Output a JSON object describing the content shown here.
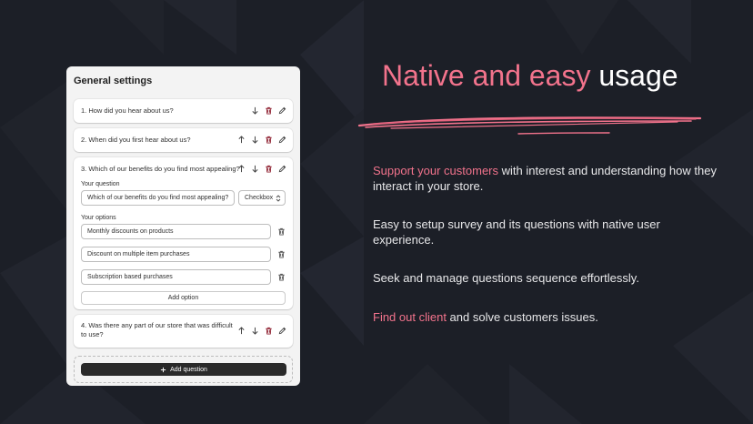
{
  "panel": {
    "title": "General settings",
    "questions": [
      {
        "label": "1. How did you hear about us?"
      },
      {
        "label": "2. When did you first hear about us?"
      },
      {
        "label": "3. Which of our benefits do you find most appealing?",
        "your_question_label": "Your question",
        "question_value": "Which of our benefits do you find most appealing?",
        "type_value": "Checkbox",
        "options_label": "Your options",
        "options": [
          "Monthly discounts on products",
          "Discount on multiple item purchases",
          "Subscription based purchases"
        ],
        "add_option_label": "Add option"
      },
      {
        "label": "4. Was there any part of our store that was difficult to use?"
      }
    ],
    "add_question_label": "Add question"
  },
  "hero": {
    "headline_accent": "Native and easy",
    "headline_rest": " usage",
    "features": [
      {
        "accent": "Support your customers",
        "rest": " with interest and understanding how they interact in your store."
      },
      {
        "accent": "",
        "rest": "Easy to setup survey and its questions with native user experience."
      },
      {
        "accent": "",
        "rest": "Seek and manage questions sequence effortlessly."
      },
      {
        "accent": "Find out client",
        "rest": " and solve customers issues."
      }
    ]
  },
  "colors": {
    "accent": "#f2738c",
    "background": "#1c1f27",
    "panel": "#f3f3f3",
    "button_dark": "#2a2a2a"
  },
  "icons": [
    "arrow-up-icon",
    "arrow-down-icon",
    "trash-icon",
    "pencil-icon",
    "chevron-updown-icon",
    "plus-icon"
  ]
}
